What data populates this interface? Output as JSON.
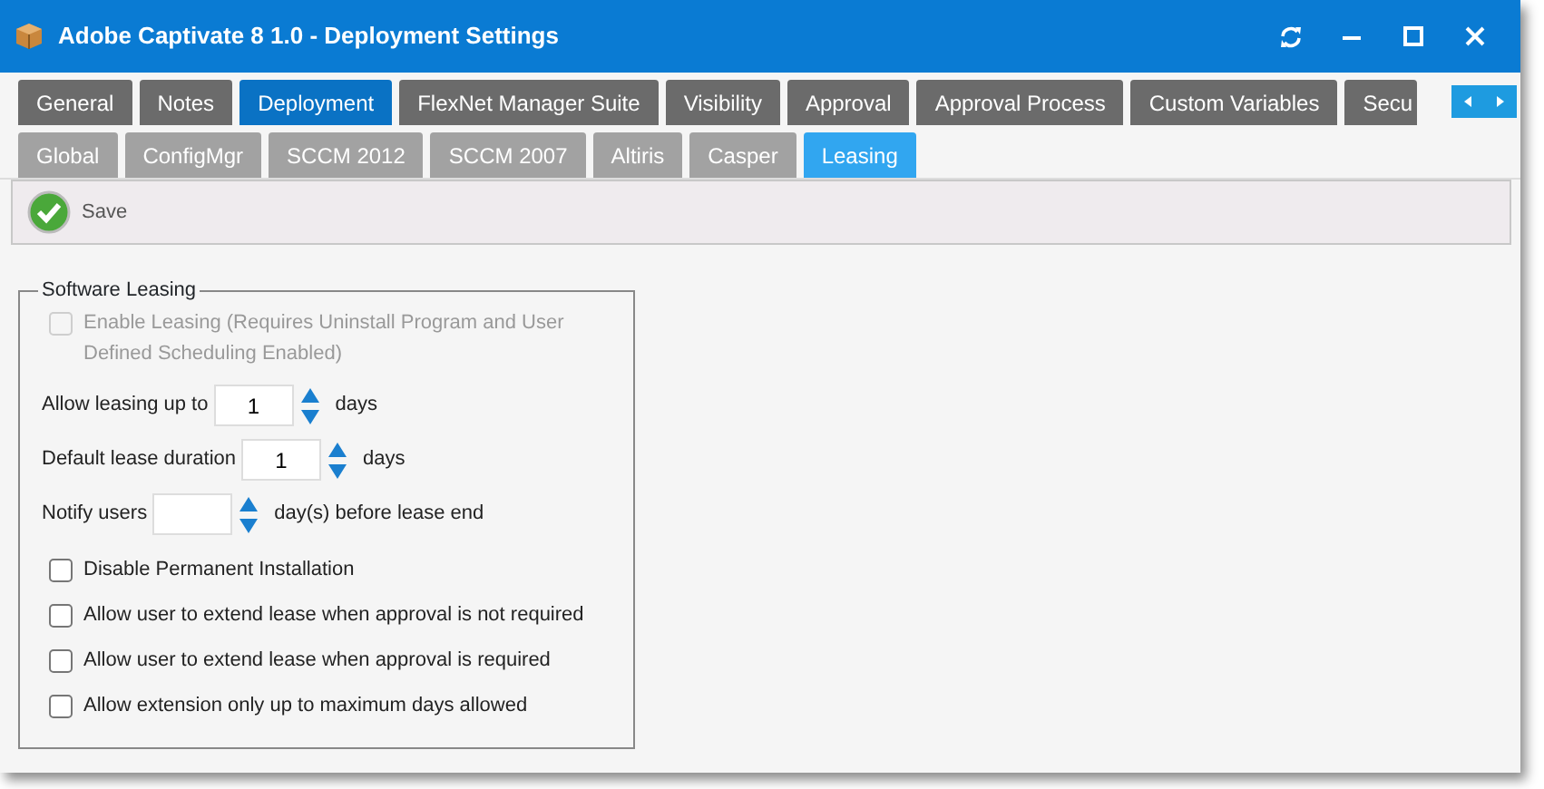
{
  "window": {
    "title": "Adobe Captivate 8 1.0 - Deployment Settings"
  },
  "tabs": [
    {
      "label": "General",
      "selected": false
    },
    {
      "label": "Notes",
      "selected": false
    },
    {
      "label": "Deployment",
      "selected": true
    },
    {
      "label": "FlexNet Manager Suite",
      "selected": false
    },
    {
      "label": "Visibility",
      "selected": false
    },
    {
      "label": "Approval",
      "selected": false
    },
    {
      "label": "Approval Process",
      "selected": false
    },
    {
      "label": "Custom Variables",
      "selected": false
    },
    {
      "label": "Secu",
      "selected": false
    }
  ],
  "subtabs": [
    {
      "label": "Global",
      "selected": false
    },
    {
      "label": "ConfigMgr",
      "selected": false
    },
    {
      "label": "SCCM 2012",
      "selected": false
    },
    {
      "label": "SCCM 2007",
      "selected": false
    },
    {
      "label": "Altiris",
      "selected": false
    },
    {
      "label": "Casper",
      "selected": false
    },
    {
      "label": "Leasing",
      "selected": true
    }
  ],
  "toolbar": {
    "save": "Save"
  },
  "group": {
    "legend": "Software Leasing",
    "enable_leasing": {
      "label": "Enable Leasing (Requires Uninstall Program and User Defined Scheduling Enabled)",
      "checked": false,
      "disabled": true
    },
    "spinners": [
      {
        "label": "Allow leasing up to",
        "value": "1",
        "unit": "days"
      },
      {
        "label": "Default lease duration",
        "value": "1",
        "unit": "days"
      },
      {
        "label": "Notify users",
        "unit": "day(s) before lease end"
      }
    ],
    "checkboxes": [
      {
        "label": "Disable Permanent Installation",
        "checked": false
      },
      {
        "label": "Allow user to extend lease when approval is not required",
        "checked": false
      },
      {
        "label": "Allow user to extend lease when approval is required",
        "checked": false
      },
      {
        "label": "Allow extension only up to maximum days allowed",
        "checked": false
      }
    ]
  }
}
